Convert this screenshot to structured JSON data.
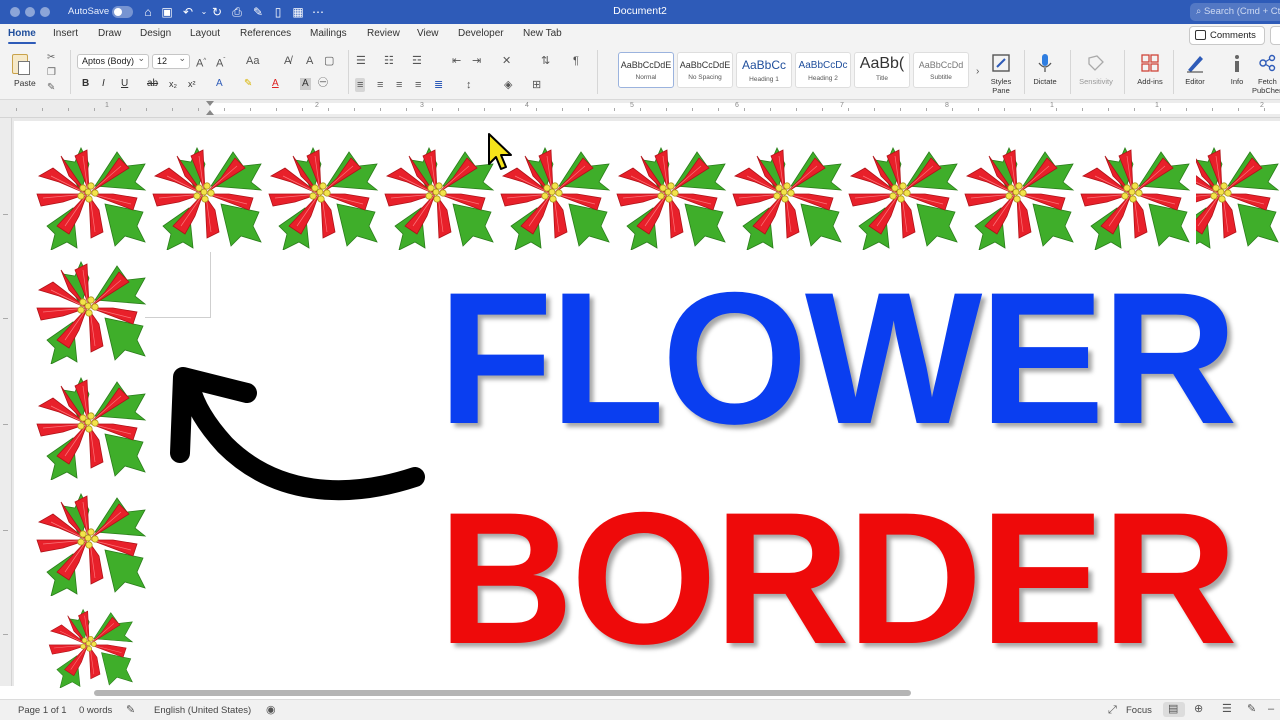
{
  "titlebar": {
    "autosave_label": "AutoSave",
    "document_title": "Document2",
    "search_placeholder": "Search (Cmd + Ctrl + U)"
  },
  "tabs": [
    {
      "label": "Home",
      "active": true
    },
    {
      "label": "Insert"
    },
    {
      "label": "Draw"
    },
    {
      "label": "Design"
    },
    {
      "label": "Layout"
    },
    {
      "label": "References"
    },
    {
      "label": "Mailings"
    },
    {
      "label": "Review"
    },
    {
      "label": "View"
    },
    {
      "label": "Developer"
    },
    {
      "label": "New Tab"
    }
  ],
  "comments_label": "Comments",
  "ribbon": {
    "paste_label": "Paste",
    "font_name": "Aptos (Body)",
    "font_size": "12",
    "styles": [
      {
        "preview": "AaBbCcDdE",
        "name": "Normal"
      },
      {
        "preview": "AaBbCcDdE",
        "name": "No Spacing"
      },
      {
        "preview": "AaBbCc",
        "name": "Heading 1"
      },
      {
        "preview": "AaBbCcDc",
        "name": "Heading 2"
      },
      {
        "preview": "AaBb(",
        "name": "Title"
      },
      {
        "preview": "AaBbCcDd",
        "name": "Subtitle"
      }
    ],
    "styles_pane_label_1": "Styles",
    "styles_pane_label_2": "Pane",
    "dictate_label": "Dictate",
    "sensitivity_label": "Sensitivity",
    "addins_label": "Add-ins",
    "editor_label": "Editor",
    "info_label": "Info",
    "fetch_label_1": "Fetch",
    "fetch_label_2": "PubChem"
  },
  "ruler_numbers": [
    "1",
    "2",
    "3",
    "4",
    "5",
    "6",
    "7",
    "8",
    "1",
    "1",
    "2",
    "3"
  ],
  "document": {
    "headline_1": "FLOWER",
    "headline_2": "BORDER"
  },
  "statusbar": {
    "page": "Page 1 of 1",
    "words": "0 words",
    "language": "English (United States)",
    "focus_label": "Focus"
  },
  "colors": {
    "title_blue": "#2e5bb8",
    "headline_blue": "#0a3ef0",
    "headline_red": "#ee0a0a",
    "petal_red": "#e8202a",
    "leaf_green": "#3fae2a"
  }
}
